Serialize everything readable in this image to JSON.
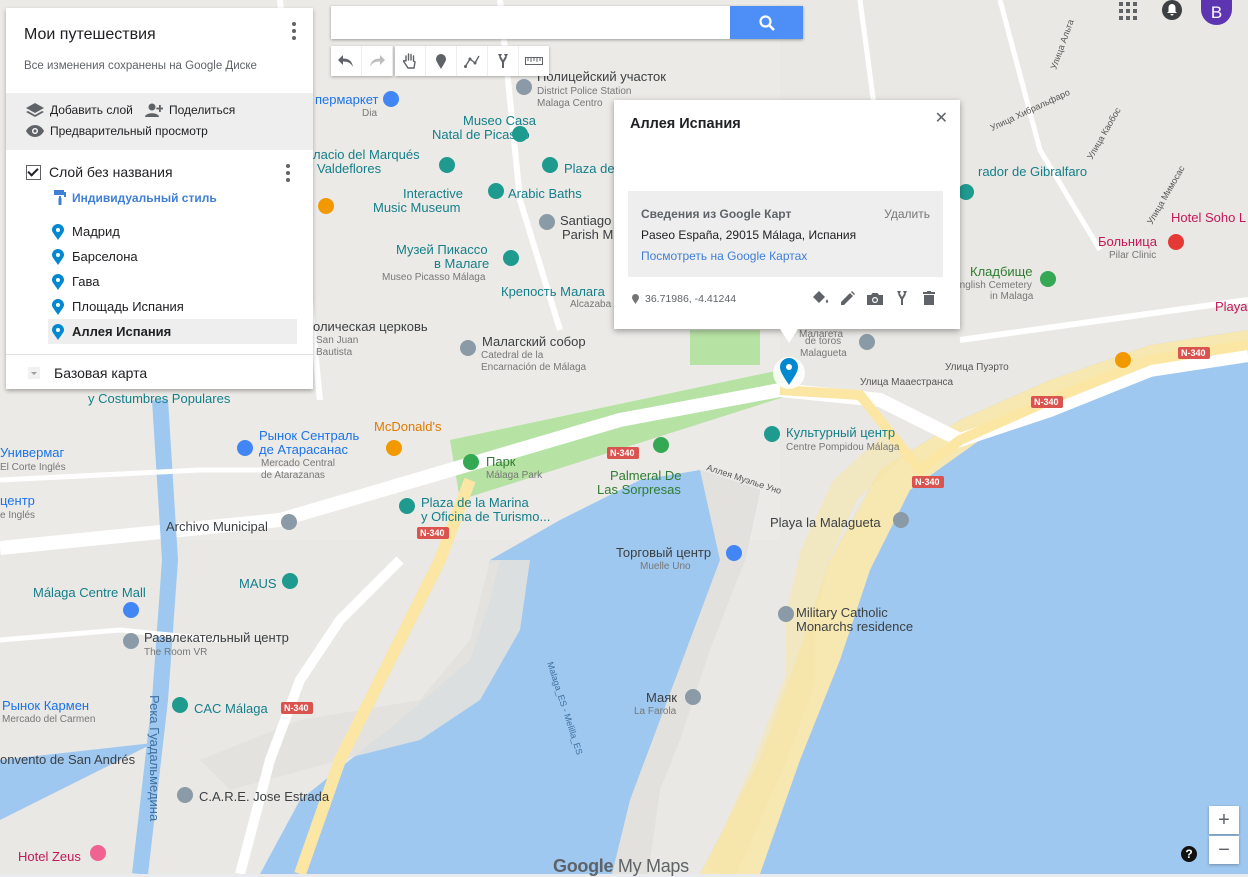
{
  "panel": {
    "title": "Мои путешествия",
    "saved_status": "Все изменения сохранены на Google Диске",
    "add_layer": "Добавить слой",
    "share": "Поделиться",
    "preview": "Предварительный просмотр",
    "layer_name": "Слой без названия",
    "style": "Индивидуальный стиль",
    "places": [
      "Мадрид",
      "Барселона",
      "Гава",
      "Площадь Испания",
      "Аллея Испания"
    ],
    "selected_place": "Аллея Испания",
    "basemap": "Базовая карта"
  },
  "search": {
    "value": "",
    "placeholder": ""
  },
  "toolbar": {
    "tools": [
      "undo-icon",
      "redo-icon",
      "hand-icon",
      "marker-icon",
      "draw-line-icon",
      "route-icon",
      "ruler-icon"
    ]
  },
  "topbar": {
    "user_initial": "B"
  },
  "info": {
    "title": "Аллея Испания",
    "google_header": "Сведения из Google Карт",
    "delete": "Удалить",
    "address": "Paseo España, 29015 Málaga, Испания",
    "link": "Посмотреть на Google Картах",
    "coords": "36.71986, -4.41244"
  },
  "map": {
    "labels": [
      {
        "text": "Полицейский участок",
        "sub": "District Police Station"
      },
      {
        "text": "Malaga Centro"
      },
      {
        "text": "пермаркет"
      },
      {
        "text": "Dia"
      },
      {
        "text": "Museo Casa"
      },
      {
        "text": "Natal de Picasso"
      },
      {
        "text": "Plaza de"
      },
      {
        "text": "лacio del Marqués"
      },
      {
        "text": "Valdeflores"
      },
      {
        "text": "Interactive"
      },
      {
        "text": "Music Museum"
      },
      {
        "text": "Arabic Baths"
      },
      {
        "text": "Santiago"
      },
      {
        "text": "Parish M"
      },
      {
        "text": "Музей Пикассо"
      },
      {
        "text": "в Малаге"
      },
      {
        "text": "Museo Picasso Málaga"
      },
      {
        "text": "Крепость Малага"
      },
      {
        "text": "Alcazaba"
      },
      {
        "text": "олическая церковь"
      },
      {
        "text": "San Juan"
      },
      {
        "text": "Bautista"
      },
      {
        "text": "Малагский собор"
      },
      {
        "text": "Catedral de la"
      },
      {
        "text": "Encarnación de Málaga"
      },
      {
        "text": "y Costumbres Populares"
      },
      {
        "text": "McDonald's"
      },
      {
        "text": "Рынок Сентраль"
      },
      {
        "text": "де Атарасанас"
      },
      {
        "text": "Mercado Central"
      },
      {
        "text": "de Atarazanas"
      },
      {
        "text": "Парк"
      },
      {
        "text": "Málaga Park"
      },
      {
        "text": "Palmeral De"
      },
      {
        "text": "Las Sorpresas"
      },
      {
        "text": "Культурный центр"
      },
      {
        "text": "Centre Pompidou Málaga"
      },
      {
        "text": "Универмаг"
      },
      {
        "text": "El Corte Inglés"
      },
      {
        "text": "центр"
      },
      {
        "text": "e Inglés"
      },
      {
        "text": "Archivo Municipal"
      },
      {
        "text": "Plaza de la Marina"
      },
      {
        "text": "y Oficina de Turismo..."
      },
      {
        "text": "Playa la Malagueta"
      },
      {
        "text": "Торговый центр"
      },
      {
        "text": "Muelle Uno"
      },
      {
        "text": "MAUS"
      },
      {
        "text": "Málaga Centre Mall"
      },
      {
        "text": "Развлекательный центр"
      },
      {
        "text": "The Room VR"
      },
      {
        "text": "Military Catholic"
      },
      {
        "text": "Monarchs residence"
      },
      {
        "text": "Маяк"
      },
      {
        "text": "La Farola"
      },
      {
        "text": "Рынок Кармен"
      },
      {
        "text": "Mercado del Carmen"
      },
      {
        "text": "CAC Málaga"
      },
      {
        "text": "onvento de San Andrés"
      },
      {
        "text": "C.A.R.E. Jose Estrada"
      },
      {
        "text": "Hotel Zeus"
      },
      {
        "text": "Река Гуадальмедина"
      },
      {
        "text": "Malaga_ES - Melilla_ES"
      },
      {
        "text": "Аллея Муэлье Уно"
      },
      {
        "text": "Улица Мааестранса"
      },
      {
        "text": "Улица Пуэрто"
      },
      {
        "text": "N-340"
      },
      {
        "text": "rador de Gibralfaro"
      },
      {
        "text": "Hotel Soho L"
      },
      {
        "text": "Больница"
      },
      {
        "text": "Pilar Clinic"
      },
      {
        "text": "Кладбище"
      },
      {
        "text": "English Cemetery"
      },
      {
        "text": "in Malaga"
      },
      {
        "text": "Playa"
      },
      {
        "text": "Улица Хибральфаро"
      },
      {
        "text": "Улица Каобос"
      },
      {
        "text": "Улица Мимосас"
      },
      {
        "text": "Улица Альта"
      },
      {
        "text": "Malagueta"
      },
      {
        "text": "de toros"
      },
      {
        "text": "Малагета"
      }
    ]
  },
  "logo": {
    "google": "Google",
    "mymaps": "My Maps"
  },
  "zoom": {
    "in": "+",
    "out": "−",
    "help": "?"
  }
}
